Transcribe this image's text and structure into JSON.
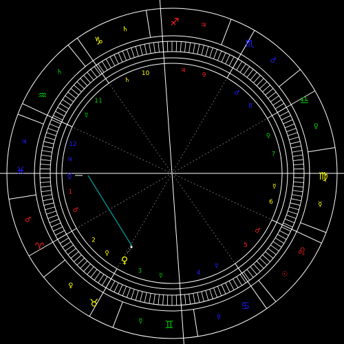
{
  "colors": {
    "background": "#000000",
    "line": "#ffffff",
    "fire": "#ff2020",
    "earth": "#ffff00",
    "air": "#00cc00",
    "water": "#2020ff",
    "aspect_line": "#00a0a0",
    "dotted": "#808080"
  },
  "signs": [
    {
      "symbol": "♈",
      "color": "fire"
    },
    {
      "symbol": "♉",
      "color": "earth"
    },
    {
      "symbol": "♊",
      "color": "air"
    },
    {
      "symbol": "♋",
      "color": "water"
    },
    {
      "symbol": "♌",
      "color": "fire"
    },
    {
      "symbol": "♍",
      "color": "earth"
    },
    {
      "symbol": "♎",
      "color": "air"
    },
    {
      "symbol": "♏",
      "color": "water"
    },
    {
      "symbol": "♐",
      "color": "fire"
    },
    {
      "symbol": "♑",
      "color": "earth"
    },
    {
      "symbol": "♒",
      "color": "air"
    },
    {
      "symbol": "♓",
      "color": "water"
    }
  ],
  "ruler_glyphs": [
    "♂",
    "♀",
    "☿",
    "☿",
    "☉",
    "☿",
    "♀",
    "♂",
    "♃",
    "♄",
    "♄",
    "♃"
  ],
  "house_numbers": [
    "1",
    "2",
    "3",
    "4",
    "5",
    "6",
    "7",
    "8",
    "9",
    "10",
    "11",
    "12"
  ],
  "house_glyphs": [
    "♂",
    "♀",
    "☿",
    "☿",
    "♂",
    "☿",
    "♀",
    "♂",
    "♃",
    "♄",
    "☿",
    "♃"
  ],
  "chart_markers": {
    "planet_left": "☿",
    "planet_lower": "♀"
  }
}
